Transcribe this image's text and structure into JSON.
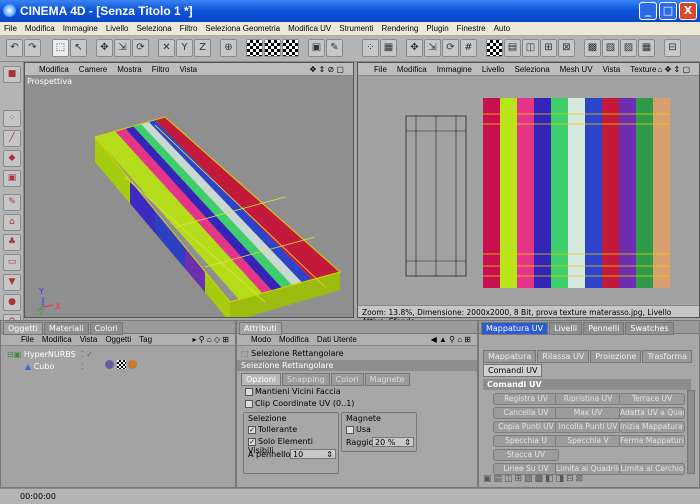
{
  "window": {
    "title": "CINEMA 4D - [Senza Titolo 1 *]",
    "min": "_",
    "max": "□",
    "close": "X"
  },
  "menu": [
    "File",
    "Modifica",
    "Immagine",
    "Livello",
    "Seleziona",
    "Filtro",
    "Seleziona Geometria",
    "Modifica UV",
    "Strumenti",
    "Rendering",
    "Plugin",
    "Finestre",
    "Auto"
  ],
  "viewport": {
    "menu": [
      "Modifica",
      "Camere",
      "Mostra",
      "Filtro",
      "Vista"
    ],
    "camera": "Prospettiva",
    "axis": {
      "x": "X",
      "y": "Y",
      "z": "Z"
    }
  },
  "uv_editor": {
    "menu": [
      "File",
      "Modifica",
      "Immagine",
      "Livello",
      "Seleziona",
      "Mesh UV",
      "Vista",
      "Texture"
    ],
    "status": "Zoom: 13.8%, Dimensione: 2000x2000, 8 Bit, prova texture materasso.jpg, Livello Attivo: Sfondo",
    "stripes": [
      "#c8104f",
      "#b5e51a",
      "#e43588",
      "#3424b8",
      "#3ecf6c",
      "#d6e9e1",
      "#2c44c9",
      "#c31a3b",
      "#6d2fb0",
      "#2f9a4a",
      "#d7a06e"
    ]
  },
  "objects": {
    "tabs": [
      "Oggetti",
      "Materiali",
      "Colori"
    ],
    "menu": [
      "File",
      "Modifica",
      "Vista",
      "Oggetti",
      "Tag"
    ],
    "items": [
      "HyperNURBS",
      "Cubo"
    ]
  },
  "attributes": {
    "tab": "Attributi",
    "menu": [
      "Modo",
      "Modifica",
      "Dati Utente"
    ],
    "tool": "Selezione Rettangolare",
    "section": "Selezione Rettangolare",
    "subtabs": [
      "Opzioni",
      "Snapping",
      "Colori",
      "Magnete"
    ],
    "mantieni": "Mantieni Vicini Faccia",
    "clip": "Clip Coordinate UV (0..1)",
    "sel_group": "Selezione",
    "tollerante": "Tollerante",
    "solo": "Solo Elementi Visibili",
    "pennello_label": "A pennello",
    "pennello_val": "10",
    "mag_group": "Magnete",
    "usa": "Usa",
    "raggio_label": "Raggio",
    "raggio_val": "20 %"
  },
  "uvpanel": {
    "tabs": [
      "Mappatura UV",
      "Livelli",
      "Pennelli",
      "Swatches"
    ],
    "subtabs": [
      "Mappatura",
      "Rilassa UV",
      "Proiezione",
      "Trasforma"
    ],
    "active_sub": "Comandi UV",
    "header": "Comandi UV",
    "buttons": [
      "Registra UV",
      "Ripristina UV",
      "Terrace UV",
      "Cancella UV",
      "Max UV",
      "Adatta UV a Quad",
      "Copia Punti UV",
      "Incolla Punti UV",
      "Inizia Mappatura I",
      "Specchia U",
      "Specchia V",
      "Ferma Mappatura",
      "Stacca UV",
      "Linee Su UV",
      "Limita al Quadrilate",
      "Limita al Cerchio"
    ]
  },
  "status": {
    "time": "00:00:00"
  },
  "colors": {
    "titlebar": "#0f55d9",
    "panel": "#a7a7a7",
    "accent": "#2c5bd6"
  }
}
